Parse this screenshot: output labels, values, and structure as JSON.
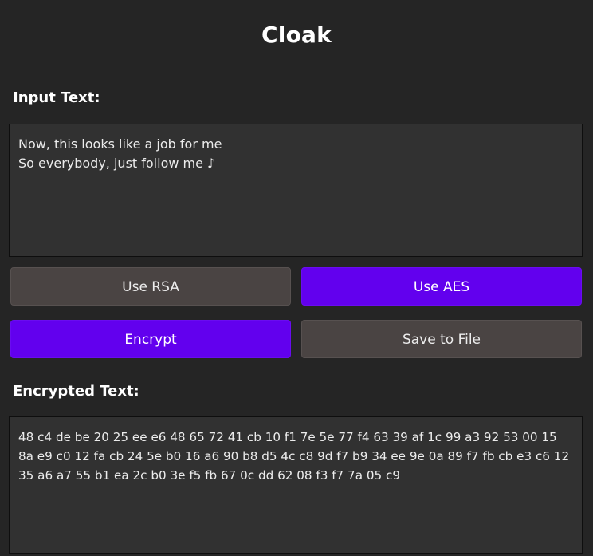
{
  "app": {
    "title": "Cloak"
  },
  "input": {
    "label": "Input Text:",
    "value": "Now, this looks like a job for me\nSo everybody, just follow me ♪"
  },
  "algorithm": {
    "rsa_label": "Use RSA",
    "aes_label": "Use AES",
    "selected": "AES"
  },
  "actions": {
    "encrypt_label": "Encrypt",
    "save_label": "Save to File"
  },
  "output": {
    "label": "Encrypted Text:",
    "value": "48 c4 de be 20 25 ee e6 48 65 72 41 cb 10 f1 7e 5e 77 f4 63 39 af 1c 99 a3 92 53 00 15 8a e9 c0 12 fa cb 24 5e b0 16 a6 90 b8 d5 4c c8 9d f7 b9 34 ee 9e 0a 89 f7 fb cb e3 c6 12 35 a6 a7 55 b1 ea 2c b0 3e f5 fb 67 0c dd 62 08 f3 f7 7a 05 c9"
  },
  "colors": {
    "background": "#252525",
    "panel": "#313131",
    "button_gray": "#4a4443",
    "accent_purple": "#6200ee"
  }
}
